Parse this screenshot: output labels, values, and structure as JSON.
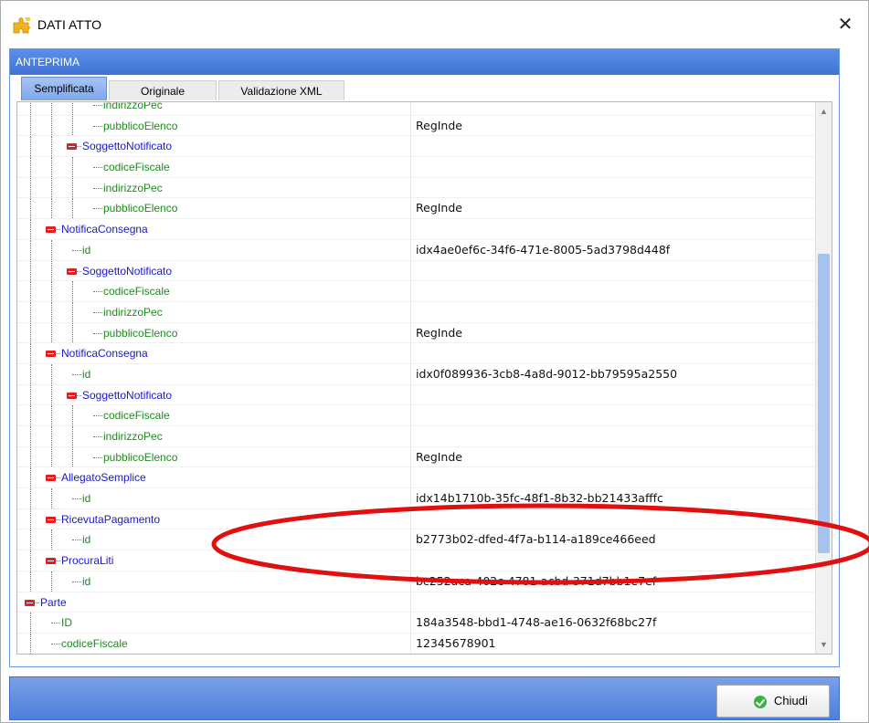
{
  "window": {
    "title": "DATI ATTO",
    "close_icon": "close-icon",
    "app_icon": "puzzle-icon"
  },
  "panel": {
    "header": "ANTEPRIMA"
  },
  "tabs": [
    {
      "label": "Semplificata",
      "active": true
    },
    {
      "label": "Originale",
      "active": false
    },
    {
      "label": "Validazione XML",
      "active": false
    }
  ],
  "tree_rows": [
    {
      "depth": 4,
      "kind": "leaf",
      "label": "indirizzoPec",
      "value": ""
    },
    {
      "depth": 4,
      "kind": "leaf",
      "label": "pubblicoElenco",
      "value": "RegInde"
    },
    {
      "depth": 3,
      "kind": "node",
      "label": "SoggettoNotificato",
      "value": ""
    },
    {
      "depth": 4,
      "kind": "leaf",
      "label": "codiceFiscale",
      "value": ""
    },
    {
      "depth": 4,
      "kind": "leaf",
      "label": "indirizzoPec",
      "value": ""
    },
    {
      "depth": 4,
      "kind": "leaf",
      "label": "pubblicoElenco",
      "value": "RegInde"
    },
    {
      "depth": 2,
      "kind": "node",
      "label": "NotificaConsegna",
      "value": ""
    },
    {
      "depth": 3,
      "kind": "leaf",
      "label": "id",
      "value": "idx4ae0ef6c-34f6-471e-8005-5ad3798d448f"
    },
    {
      "depth": 3,
      "kind": "node",
      "label": "SoggettoNotificato",
      "value": ""
    },
    {
      "depth": 4,
      "kind": "leaf",
      "label": "codiceFiscale",
      "value": ""
    },
    {
      "depth": 4,
      "kind": "leaf",
      "label": "indirizzoPec",
      "value": ""
    },
    {
      "depth": 4,
      "kind": "leaf",
      "label": "pubblicoElenco",
      "value": "RegInde"
    },
    {
      "depth": 2,
      "kind": "node",
      "label": "NotificaConsegna",
      "value": ""
    },
    {
      "depth": 3,
      "kind": "leaf",
      "label": "id",
      "value": "idx0f089936-3cb8-4a8d-9012-bb79595a2550"
    },
    {
      "depth": 3,
      "kind": "node",
      "label": "SoggettoNotificato",
      "value": ""
    },
    {
      "depth": 4,
      "kind": "leaf",
      "label": "codiceFiscale",
      "value": ""
    },
    {
      "depth": 4,
      "kind": "leaf",
      "label": "indirizzoPec",
      "value": ""
    },
    {
      "depth": 4,
      "kind": "leaf",
      "label": "pubblicoElenco",
      "value": "RegInde"
    },
    {
      "depth": 2,
      "kind": "node",
      "label": "AllegatoSemplice",
      "value": ""
    },
    {
      "depth": 3,
      "kind": "leaf",
      "label": "id",
      "value": "idx14b1710b-35fc-48f1-8b32-bb21433afffc"
    },
    {
      "depth": 2,
      "kind": "node",
      "label": "RicevutaPagamento",
      "value": ""
    },
    {
      "depth": 3,
      "kind": "leaf",
      "label": "id",
      "value": "b2773b02-dfed-4f7a-b114-a189ce466eed"
    },
    {
      "depth": 2,
      "kind": "node",
      "label": "ProcuraLiti",
      "value": ""
    },
    {
      "depth": 3,
      "kind": "leaf",
      "label": "id",
      "value": "bc252aca-402c-4781-acbd-371d7bb1e7ef"
    },
    {
      "depth": 1,
      "kind": "node",
      "label": "Parte",
      "value": ""
    },
    {
      "depth": 2,
      "kind": "leaf",
      "label": "ID",
      "value": "184a3548-bbd1-4748-ae16-0632f68bc27f"
    },
    {
      "depth": 2,
      "kind": "leaf",
      "label": "codiceFiscale",
      "value": "12345678901"
    }
  ],
  "scrollbar": {
    "position": 0.62
  },
  "footer": {
    "close_label": "Chiudi",
    "close_icon": "check-circle-icon"
  },
  "colors": {
    "accent": "#4a7fdc",
    "leaf_text": "#1e8a1e",
    "node_text": "#1818c8",
    "expand_icon": "#e02020",
    "annotation": "#e01010"
  }
}
